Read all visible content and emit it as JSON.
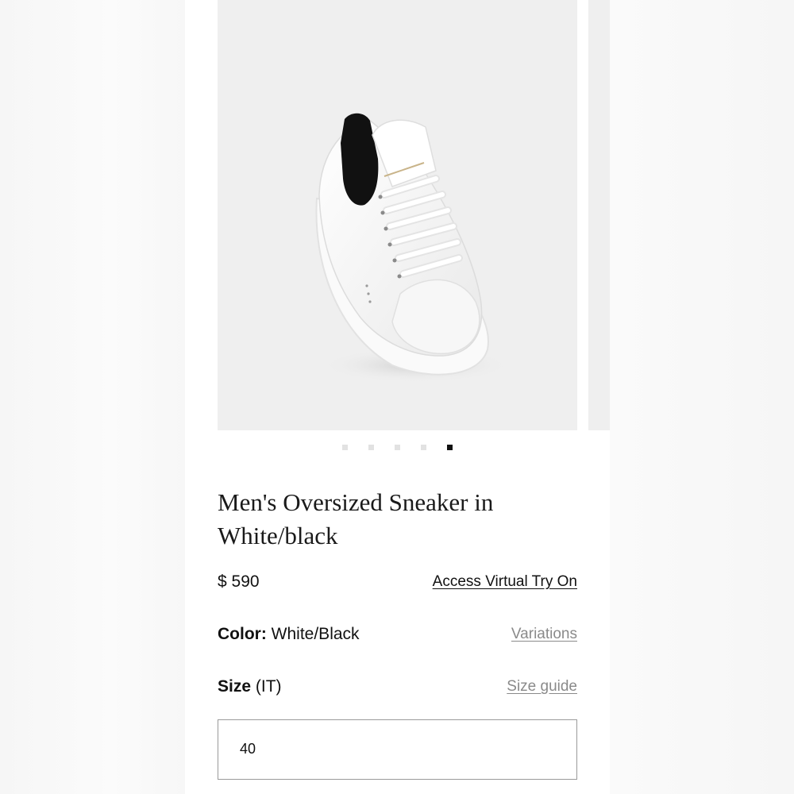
{
  "product": {
    "title": "Men's Oversized Sneaker in White/black",
    "price": "$ 590",
    "virtual_try_on_label": "Access Virtual Try On"
  },
  "gallery": {
    "image_alt": "White leather oversized sneaker with black heel tab",
    "dot_count": 5,
    "active_dot": 5
  },
  "color": {
    "label": "Color:",
    "value": "White/Black",
    "variations_label": "Variations"
  },
  "size": {
    "label": "Size",
    "unit": "(IT)",
    "guide_label": "Size guide",
    "selected_value": "40"
  },
  "colors": {
    "background": "#ffffff",
    "image_bg": "#efefef",
    "active_dot": "#111111",
    "inactive_dot": "#e2e2e2",
    "muted_link": "#8a8a8a"
  }
}
